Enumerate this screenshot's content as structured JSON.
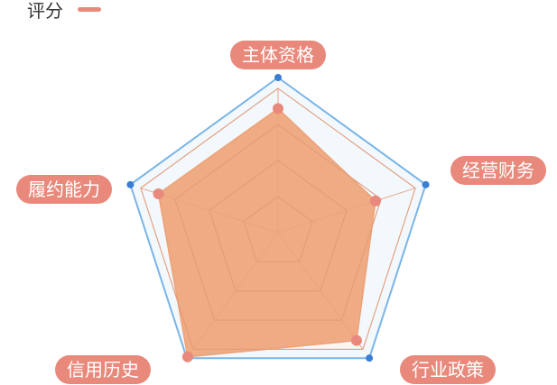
{
  "chart_data": {
    "type": "radar",
    "legend": {
      "placement": "top-left"
    },
    "indicators": [
      "主体资格",
      "经营财务",
      "行业政策",
      "信用历史",
      "履约能力"
    ],
    "series": [
      {
        "name": "评分",
        "values": [
          0.8,
          0.66,
          0.86,
          0.99,
          0.81
        ],
        "color": "#e8897c",
        "fill": "#eda277"
      },
      {
        "values": [
          1.0,
          1.0,
          1.0,
          1.0,
          1.0
        ],
        "color": "#7ab5e8",
        "fill": "#f3f8fd",
        "point_color": "#3a7fd4"
      }
    ],
    "max": 1,
    "rings": 4,
    "colors": {
      "label_bg": "#e8897c",
      "label_text": "#ffffff",
      "grid": "#e3a888"
    }
  }
}
